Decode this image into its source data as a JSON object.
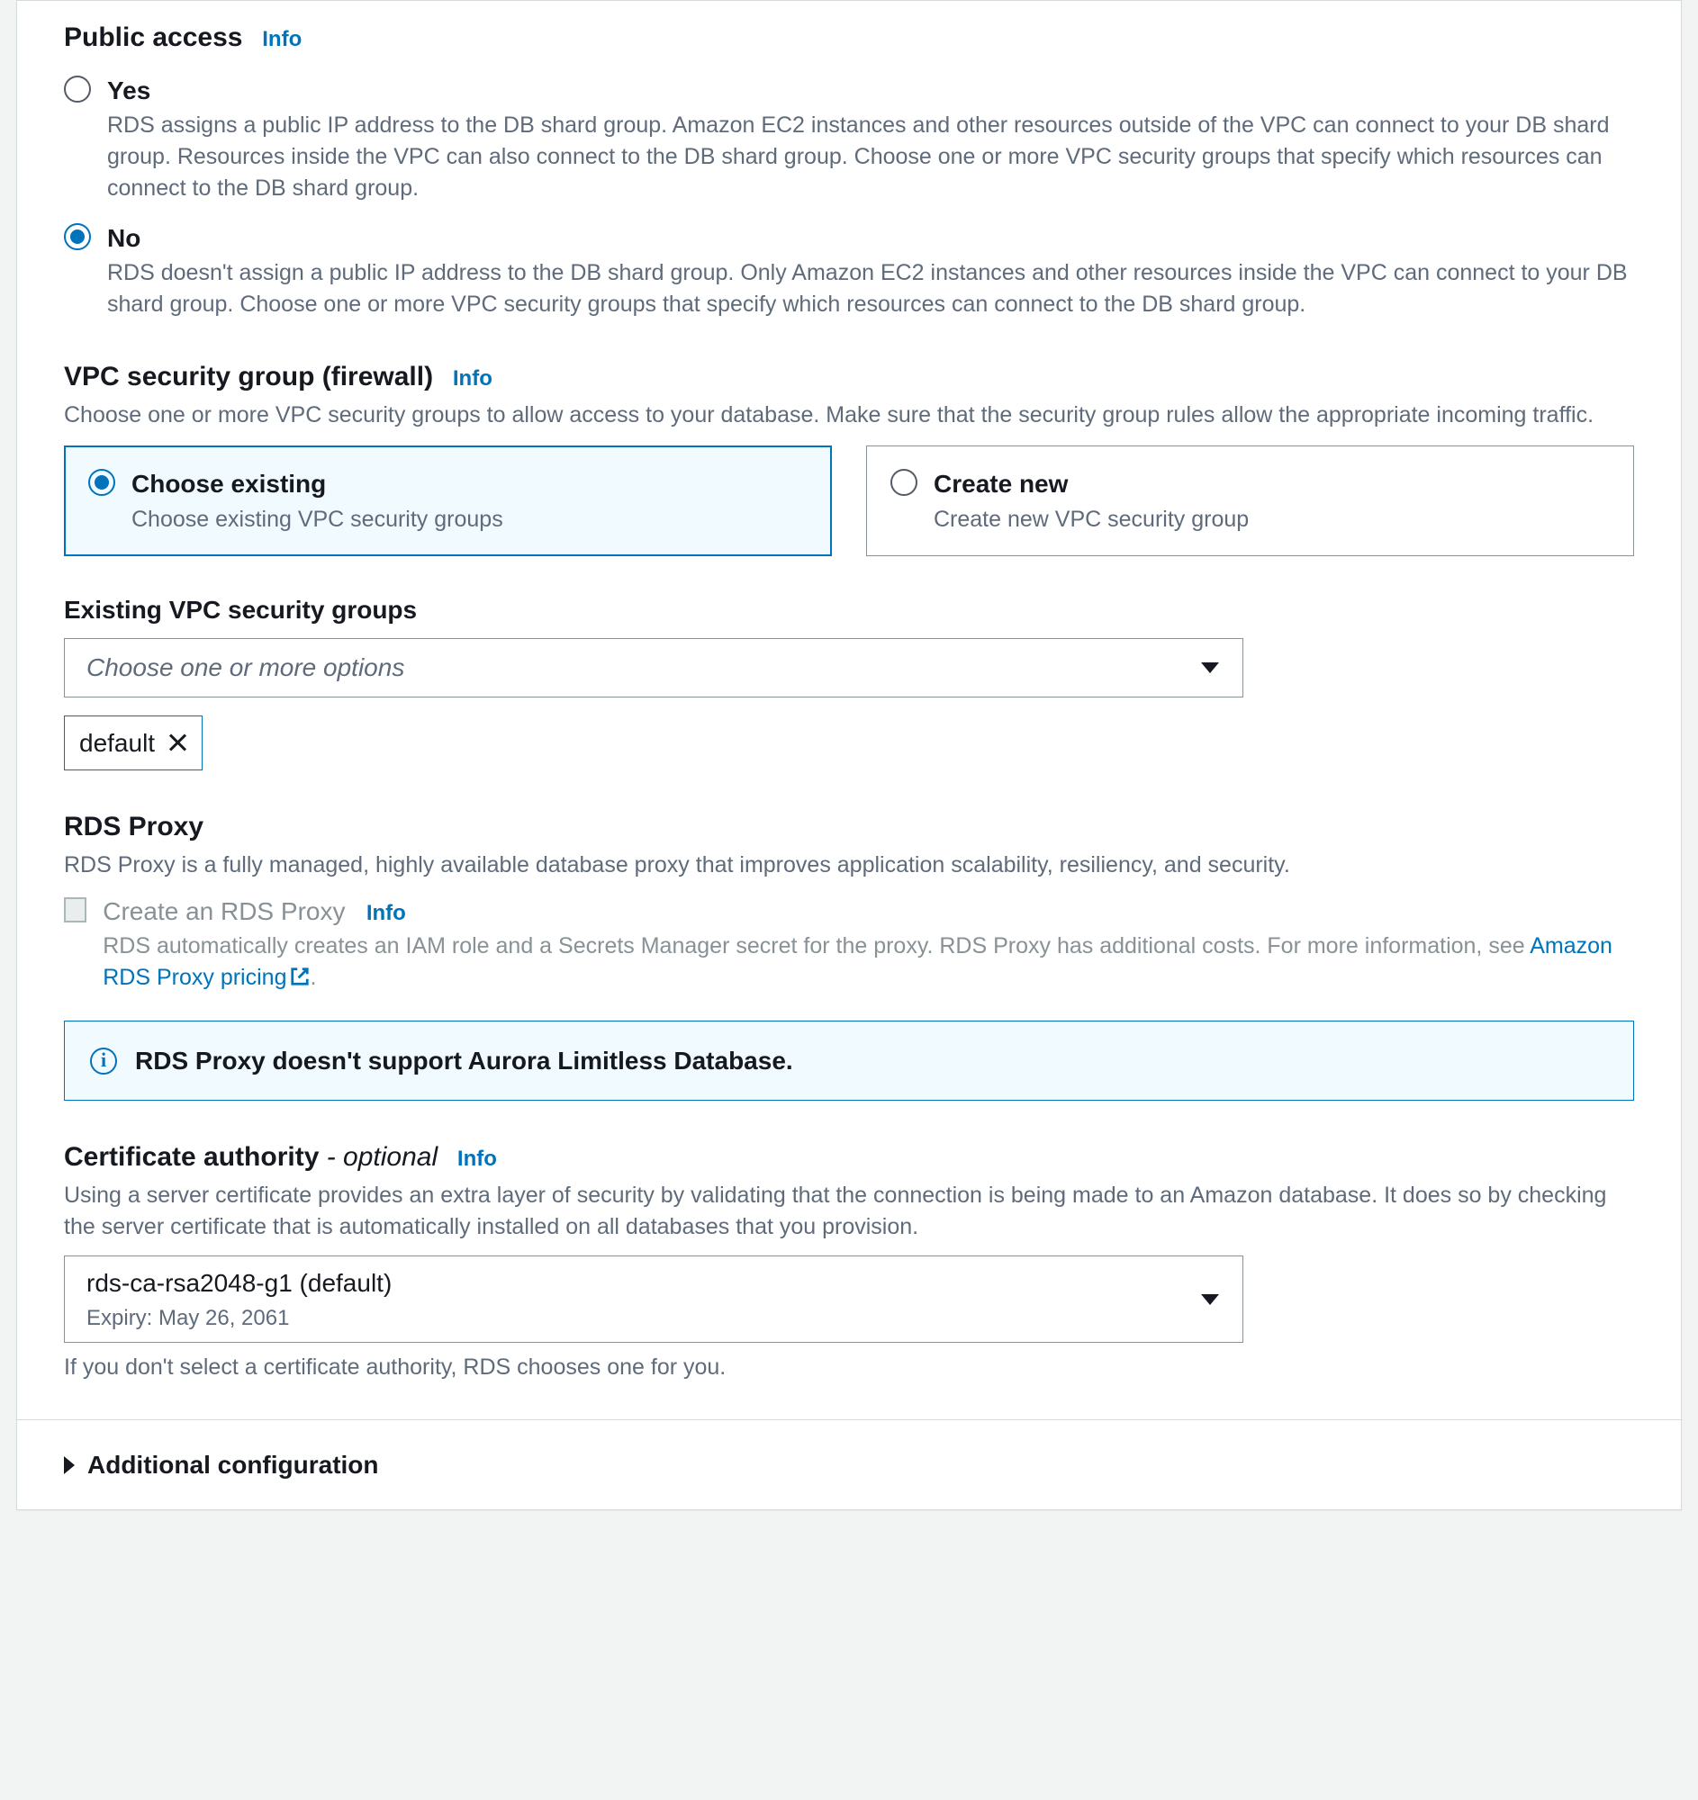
{
  "publicAccess": {
    "title": "Public access",
    "info": "Info",
    "yes": {
      "label": "Yes",
      "desc": "RDS assigns a public IP address to the DB shard group. Amazon EC2 instances and other resources outside of the VPC can connect to your DB shard group. Resources inside the VPC can also connect to the DB shard group. Choose one or more VPC security groups that specify which resources can connect to the DB shard group."
    },
    "no": {
      "label": "No",
      "desc": "RDS doesn't assign a public IP address to the DB shard group. Only Amazon EC2 instances and other resources inside the VPC can connect to your DB shard group. Choose one or more VPC security groups that specify which resources can connect to the DB shard group."
    }
  },
  "sg": {
    "title": "VPC security group (firewall)",
    "info": "Info",
    "desc": "Choose one or more VPC security groups to allow access to your database. Make sure that the security group rules allow the appropriate incoming traffic.",
    "existing": {
      "label": "Choose existing",
      "desc": "Choose existing VPC security groups"
    },
    "createNew": {
      "label": "Create new",
      "desc": "Create new VPC security group"
    },
    "existingLabel": "Existing VPC security groups",
    "placeholder": "Choose one or more options",
    "token": "default"
  },
  "proxy": {
    "title": "RDS Proxy",
    "desc": "RDS Proxy is a fully managed, highly available database proxy that improves application scalability, resiliency, and security.",
    "checkboxLabel": "Create an RDS Proxy",
    "info": "Info",
    "checkboxDescPrefix": "RDS automatically creates an IAM role and a Secrets Manager secret for the proxy. RDS Proxy has additional costs. For more information, see ",
    "pricingLink": "Amazon RDS Proxy pricing",
    "alert": "RDS Proxy doesn't support Aurora Limitless Database."
  },
  "ca": {
    "title": "Certificate authority",
    "optional": " - optional",
    "info": "Info",
    "desc": "Using a server certificate provides an extra layer of security by validating that the connection is being made to an Amazon database. It does so by checking the server certificate that is automatically installed on all databases that you provision.",
    "value": "rds-ca-rsa2048-g1 (default)",
    "expiry": "Expiry: May 26, 2061",
    "hint": "If you don't select a certificate authority, RDS chooses one for you."
  },
  "additional": {
    "label": "Additional configuration"
  }
}
